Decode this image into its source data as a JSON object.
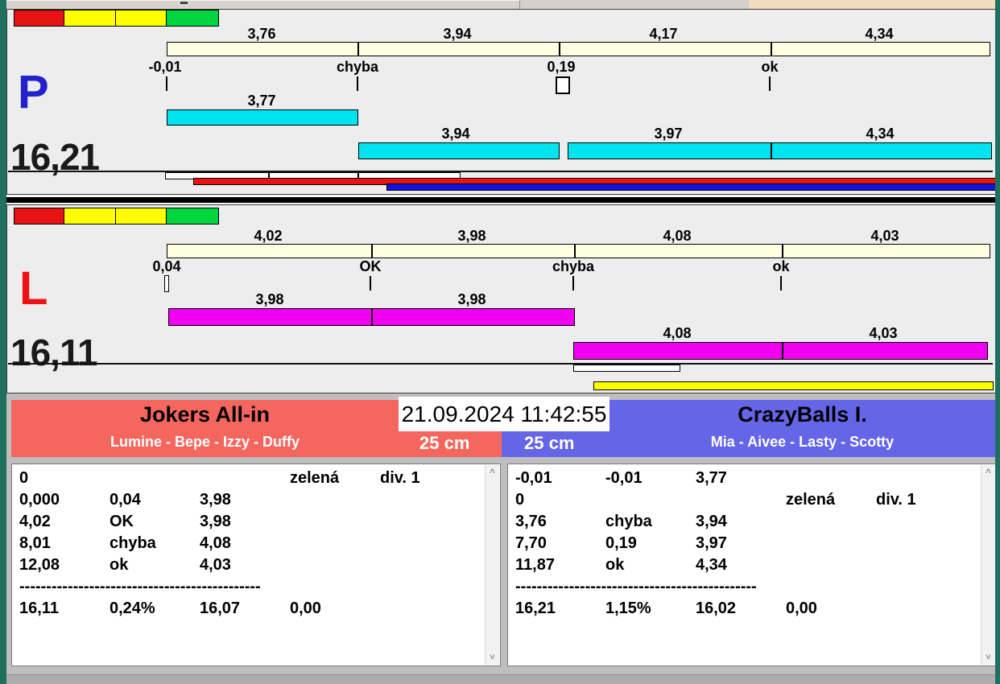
{
  "colors": {
    "teal_frame": "#20705F",
    "beige_strip": "#F2DCC0",
    "panel_bg": "#EDEDED",
    "section_bg": "#BEBEBE",
    "cream_bar": "#FFFFE1",
    "cyan_bar": "#00E4F0",
    "magenta_bar": "#F000F0",
    "red": "#E81414",
    "yellow": "#FFFF00",
    "green": "#00D540",
    "blue_bar": "#1212DE",
    "p_letter_blue": "#2222CC",
    "l_letter_red": "#EE1111",
    "team_left_bg": "#F4665E",
    "team_right_bg": "#6565E8"
  },
  "panel_p": {
    "letter": "P",
    "total": "16,21",
    "ruler_labels": [
      "3,76",
      "3,94",
      "4,17",
      "4,34"
    ],
    "mark_labels": [
      "-0,01",
      "chyba",
      "0,19",
      "ok"
    ],
    "bar_row1_label": "3,77",
    "bar_row2_labels": [
      "3,94",
      "3,97",
      "4,34"
    ]
  },
  "panel_l": {
    "letter": "L",
    "total": "16,11",
    "ruler_labels": [
      "4,02",
      "3,98",
      "4,08",
      "4,03"
    ],
    "mark_labels": [
      "0,04",
      "OK",
      "chyba",
      "ok"
    ],
    "bar_row1_labels": [
      "3,98",
      "3,98"
    ],
    "bar_row2_labels": [
      "4,08",
      "4,03"
    ]
  },
  "footer": {
    "timestamp": "21.09.2024 11:42:55",
    "left_team": {
      "name": "Jokers All-in",
      "players": "Lumine - Bepe - Izzy - Duffy",
      "distance": "25 cm",
      "rows": [
        [
          "0",
          "",
          "",
          "zelená",
          "div. 1"
        ],
        [
          "0,000",
          "0,04",
          "3,98",
          "",
          ""
        ],
        [
          "4,02",
          "OK",
          "3,98",
          "",
          ""
        ],
        [
          "8,01",
          "chyba",
          "4,08",
          "",
          ""
        ],
        [
          "12,08",
          "ok",
          "4,03",
          "",
          ""
        ],
        [
          "---------------------------------------------",
          "",
          "",
          "",
          ""
        ],
        [
          "16,11",
          "0,24%",
          "16,07",
          "0,00",
          ""
        ]
      ]
    },
    "right_team": {
      "name": "CrazyBalls I.",
      "players": "Mia - Aivee - Lasty - Scotty",
      "distance": "25 cm",
      "rows": [
        [
          "-0,01",
          "-0,01",
          "3,77",
          "",
          ""
        ],
        [
          "0",
          "",
          "",
          "zelená",
          "div. 1"
        ],
        [
          "3,76",
          "chyba",
          "3,94",
          "",
          ""
        ],
        [
          "7,70",
          "0,19",
          "3,97",
          "",
          ""
        ],
        [
          "11,87",
          "ok",
          "4,34",
          "",
          ""
        ],
        [
          "---------------------------------------------",
          "",
          "",
          "",
          ""
        ],
        [
          "16,21",
          "1,15%",
          "16,02",
          "0,00",
          ""
        ]
      ]
    }
  },
  "scrollbar": {
    "up": "˄",
    "down": "˅"
  }
}
